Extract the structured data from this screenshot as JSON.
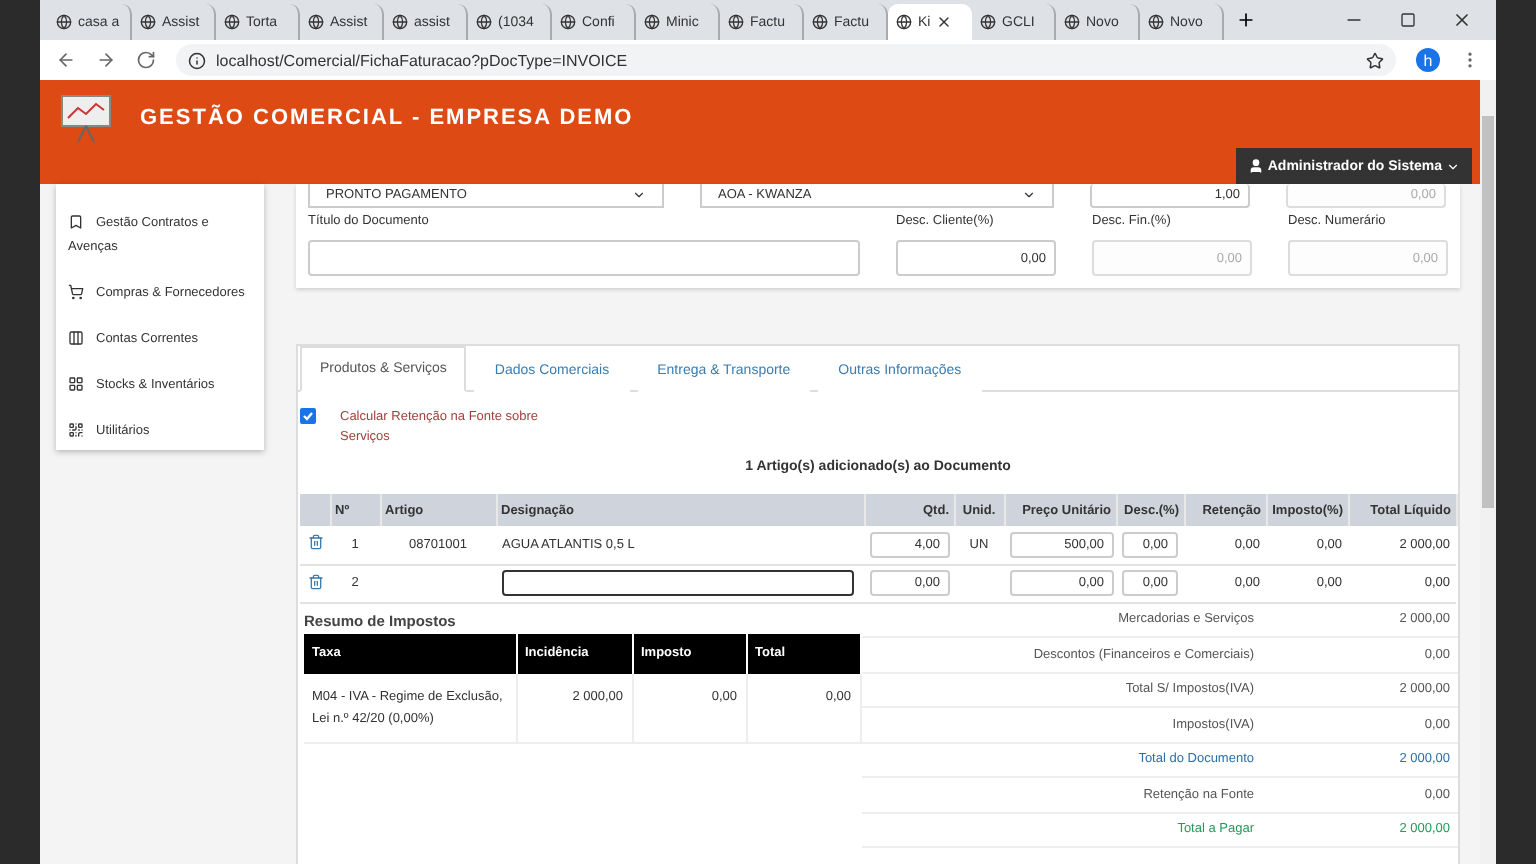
{
  "browser_tabs": [
    {
      "label": "casa a",
      "selected": false
    },
    {
      "label": "Assist",
      "selected": false
    },
    {
      "label": "Torta",
      "selected": false
    },
    {
      "label": "Assist",
      "selected": false
    },
    {
      "label": "assist",
      "selected": false
    },
    {
      "label": "(1034",
      "selected": false
    },
    {
      "label": "Confi",
      "selected": false
    },
    {
      "label": "Minic",
      "selected": false
    },
    {
      "label": "Factu",
      "selected": false
    },
    {
      "label": "Factu",
      "selected": false
    },
    {
      "label": "Ki",
      "selected": true
    },
    {
      "label": "GCLI",
      "selected": false
    },
    {
      "label": "Novo",
      "selected": false
    },
    {
      "label": "Novo",
      "selected": false
    }
  ],
  "address_bar": {
    "url": "localhost/Comercial/FichaFaturacao?pDocType=INVOICE",
    "profile": "h"
  },
  "header": {
    "title": "GESTÃO COMERCIAL - EMPRESA DEMO",
    "user": "Administrador do Sistema"
  },
  "sidebar": {
    "items": [
      "Gestão Contratos e Avenças",
      "Compras & Fornecedores",
      "Contas Correntes",
      "Stocks & Inventários",
      "Utilitários"
    ]
  },
  "form": {
    "payment": "PRONTO PAGAMENTO",
    "currency": "AOA - KWANZA",
    "exchange": "1,00",
    "field_4": "0,00",
    "fields": [
      {
        "label": "Título do Documento",
        "disabled": false
      },
      {
        "label": "Desc. Cliente(%)",
        "value": "0,00",
        "disabled": false
      },
      {
        "label": "Desc. Fin.(%)",
        "value": "0,00",
        "disabled": true
      },
      {
        "label": "Desc. Numerário",
        "value": "0,00",
        "disabled": true
      }
    ]
  },
  "tabs": [
    {
      "label": "Produtos & Serviços",
      "selected": true
    },
    {
      "label": "Dados Comerciais",
      "selected": false
    },
    {
      "label": "Entrega & Transporte",
      "selected": false
    },
    {
      "label": "Outras Informações",
      "selected": false
    }
  ],
  "withholding": {
    "label": "Calcular Retenção na Fonte sobre Serviços",
    "checked": true
  },
  "items_title": "1 Artigo(s) adicionado(s) ao Documento",
  "table": {
    "columns": [
      "Nº",
      "Artigo",
      "Designação",
      "Qtd.",
      "Unid.",
      "Preço Unitário",
      "Desc.(%)",
      "Retenção",
      "Imposto(%)",
      "Total Líquido"
    ],
    "rows": [
      {
        "kind": "item",
        "number": "1",
        "article": "08701001",
        "designation": "AGUA ATLANTIS 0,5 L",
        "qty": "4,00",
        "unit": "UN",
        "price": "500,00",
        "discount": "0,00",
        "retention": "0,00",
        "tax": "0,00",
        "total": "2 000,00"
      },
      {
        "kind": "new",
        "number": "2",
        "qty": "0,00",
        "price": "0,00",
        "discount": "0,00",
        "retention": "0,00",
        "tax": "0,00",
        "total": "0,00"
      }
    ]
  },
  "tax_summary": {
    "title": "Resumo de Impostos",
    "columns": [
      "Taxa",
      "Incidência",
      "Imposto",
      "Total"
    ],
    "rows": [
      [
        "M04 - IVA - Regime de Exclusão, Lei n.º 42/20 (0,00%)",
        "2 000,00",
        "0,00",
        "0,00"
      ]
    ]
  },
  "totals": [
    {
      "label": "Mercadorias e Serviços",
      "value": "2 000,00",
      "color": "#555555"
    },
    {
      "label": "Descontos (Financeiros e Comerciais)",
      "value": "0,00",
      "color": "#555555"
    },
    {
      "label": "Total S/ Impostos(IVA)",
      "value": "2 000,00",
      "color": "#555555"
    },
    {
      "label": "Impostos(IVA)",
      "value": "0,00",
      "color": "#555555"
    },
    {
      "label": "Total do Documento",
      "value": "2 000,00",
      "color": "#2a6fa8"
    },
    {
      "label": "Retenção na Fonte",
      "value": "0,00",
      "color": "#555555"
    },
    {
      "label": "Total a Pagar",
      "value": "2 000,00",
      "color": "#23995a"
    }
  ]
}
